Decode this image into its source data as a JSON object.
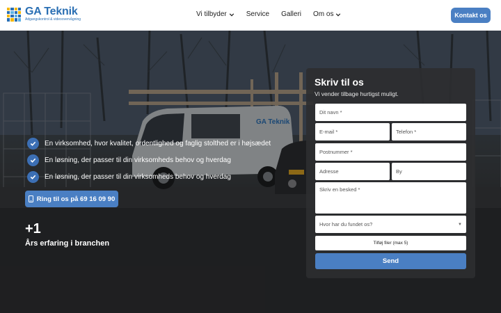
{
  "header": {
    "logo_name": "GA Teknik",
    "logo_tagline": "Adgangskontrol & videoovervågning",
    "nav": [
      {
        "label": "Vi tilbyder",
        "has_dropdown": true
      },
      {
        "label": "Service",
        "has_dropdown": false
      },
      {
        "label": "Galleri",
        "has_dropdown": false
      },
      {
        "label": "Om os",
        "has_dropdown": true
      }
    ],
    "cta_label": "Kontakt os"
  },
  "hero": {
    "checks": [
      "En virksomhed, hvor kvalitet, ordentlighed og faglig stolthed er i højsædet",
      "En løsning, der passer til din virksomheds behov og hverdag",
      "En løsning, der passer til din virksomheds behov og hverdag"
    ],
    "call_label": "Ring til os på 69 16 09 90",
    "stat_number": "+1",
    "stat_label": "Års erfaring i branchen",
    "van_text": "GA Teknik"
  },
  "form": {
    "title": "Skriv til os",
    "subtitle": "Vi vender tilbage hurtigst muligt.",
    "name_placeholder": "Dit navn *",
    "email_placeholder": "E-mail *",
    "phone_placeholder": "Telefon *",
    "postal_placeholder": "Postnummer *",
    "address_placeholder": "Adresse",
    "city_placeholder": "By",
    "message_placeholder": "Skriv en besked *",
    "source_placeholder": "Hvor har du fundet os?",
    "file_label": "Tilføj filer (max 5)",
    "send_label": "Send"
  },
  "colors": {
    "accent": "#4a7fc3",
    "logo_blue": "#2a6fb3",
    "check_blue": "#3c6fb4"
  }
}
